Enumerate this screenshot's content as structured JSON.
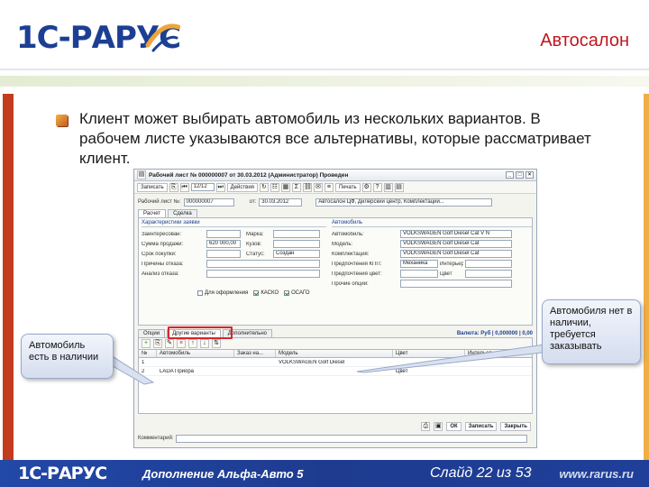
{
  "header": {
    "logo_text": "1С-РАРУС",
    "slide_title": "Автосалон"
  },
  "bullet": {
    "text": "Клиент может выбирать автомобиль из нескольких вариантов. В рабочем листе указываются все альтернативы, которые рассматривает клиент."
  },
  "window": {
    "title": "Рабочий лист № 000000007 от 30.03.2012 (Администратор) Проведен",
    "controls": [
      "_",
      "□",
      "×"
    ],
    "toolbar": {
      "save_label": "Записать",
      "nav_value": "12/12",
      "action_label": "Действия",
      "print_label": "Печать"
    },
    "doc": {
      "number_label": "Рабочий лист №:",
      "number_value": "000000007",
      "date_label": "от:",
      "date_value": "30.03.2012",
      "base_value": "Автосалон ЦФ, Дилерский центр, Комплектации..."
    },
    "subtabs": [
      "Расчет",
      "Сделка"
    ],
    "need_panel": {
      "title": "Характеристики заявки",
      "fields": [
        {
          "label": "Заинтересован:",
          "value": ""
        },
        {
          "label": "Сумма продажи:",
          "value": "620 000,00"
        },
        {
          "label": "Срок покупки:",
          "value": ""
        },
        {
          "label": "Причины отказа:",
          "value": ""
        },
        {
          "label": "Анализ отказа:",
          "value": ""
        }
      ],
      "mid_fields": [
        {
          "label": "Марка:",
          "value": ""
        },
        {
          "label": "Кузов:",
          "value": ""
        },
        {
          "label": "Статус:",
          "value": "Создан"
        }
      ],
      "checks": [
        {
          "label": "Для оформления",
          "on": false
        },
        {
          "label": "КАСКО",
          "on": true
        },
        {
          "label": "ОСАГО",
          "on": true
        }
      ]
    },
    "car_panel": {
      "title": "Автомобиль",
      "fields": [
        {
          "label": "Автомобиль:",
          "value": "VOLKSWAGEN Golf Diesel Cat V N"
        },
        {
          "label": "Модель:",
          "value": "VOLKSWAGEN Golf Diesel Cat"
        },
        {
          "label": "Комплектация:",
          "value": "VOLKSWAGEN Golf Diesel Cat"
        },
        {
          "label": "Предпочтения КПП:",
          "value": "Механика"
        },
        {
          "label": "Предпочтения цвет:",
          "value": ""
        },
        {
          "label": "Прочие опции:",
          "value": ""
        }
      ],
      "side_fields": [
        {
          "label": "Интерьер",
          "value": ""
        },
        {
          "label": "Цвет",
          "value": ""
        }
      ]
    },
    "bottom_tabs": [
      "Опции",
      "Другие варианты",
      "Дополнительно"
    ],
    "bottom_total": "Валюта: Руб | 0,000000 | 0,00",
    "grid": {
      "columns": [
        "№",
        "Автомобиль",
        "Заказ на...",
        "Модель",
        "Цвет",
        "Интерьер"
      ],
      "rows": [
        [
          "1",
          "",
          "",
          "VOLKSWAGEN Golf Diesel",
          "",
          ""
        ],
        [
          "2",
          "LADA Приора",
          "",
          "",
          "Цвет",
          ""
        ]
      ]
    },
    "ok_label": "ОК",
    "save_label": "Записать",
    "close_label": "Закрыть",
    "comment_label": "Комментарий:"
  },
  "callouts": {
    "left": "Автомобиль есть в наличии",
    "right": "Автомобиля нет в наличии, требуется заказывать"
  },
  "footer": {
    "logo_text": "1С-РАРУС",
    "product": "Дополнение Альфа-Авто 5",
    "slide_counter": "Слайд 22 из 53",
    "url": "www.rarus.ru"
  },
  "colors": {
    "brand_blue": "#1c3f94",
    "heading_red": "#c0181e",
    "highlight_red": "#d8262a",
    "left_bar": "#c43c1e",
    "right_bar": "#f0ae45"
  }
}
